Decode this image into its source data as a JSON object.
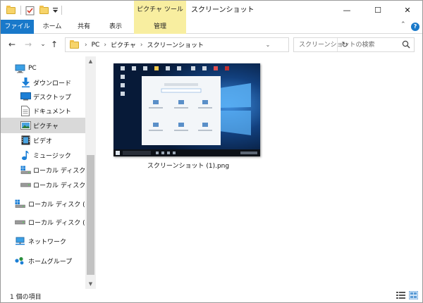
{
  "window": {
    "title": "スクリーンショット",
    "context_tab_title": "ピクチャ ツール",
    "controls": {
      "minimize": "—",
      "maximize": "☐",
      "close": "✕"
    }
  },
  "ribbon": {
    "tabs": [
      {
        "label": "ファイル"
      },
      {
        "label": "ホーム"
      },
      {
        "label": "共有"
      },
      {
        "label": "表示"
      },
      {
        "label": "管理"
      }
    ],
    "collapse_glyph": "⌃",
    "help_glyph": "?"
  },
  "address": {
    "back_glyph": "←",
    "forward_glyph": "→",
    "recent_glyph": "⌄",
    "up_glyph": "↑",
    "crumbs": [
      "PC",
      "ピクチャ",
      "スクリーンショット"
    ],
    "crumb_separator": "›",
    "refresh_glyph": "↻",
    "dropdown_glyph": "⌄",
    "search_placeholder": "スクリーンショットの検索"
  },
  "navpane": {
    "items": [
      {
        "label": "PC",
        "icon": "computer-icon"
      },
      {
        "label": "ダウンロード",
        "icon": "download-icon"
      },
      {
        "label": "デスクトップ",
        "icon": "desktop-icon"
      },
      {
        "label": "ドキュメント",
        "icon": "documents-icon"
      },
      {
        "label": "ピクチャ",
        "icon": "pictures-icon",
        "selected": true
      },
      {
        "label": "ビデオ",
        "icon": "videos-icon"
      },
      {
        "label": "ミュージック",
        "icon": "music-icon"
      },
      {
        "label": "ローカル ディスク (C",
        "icon": "os-drive-icon"
      },
      {
        "label": "ローカル ディスク (D",
        "icon": "drive-icon"
      },
      {
        "label": "ローカル ディスク (C:)",
        "icon": "os-drive-icon"
      },
      {
        "label": "ローカル ディスク (D:)",
        "icon": "drive-icon"
      },
      {
        "label": "ネットワーク",
        "icon": "network-icon"
      },
      {
        "label": "ホームグループ",
        "icon": "homegroup-icon"
      }
    ]
  },
  "files": [
    {
      "name": "スクリーンショット (1).png",
      "thumbnail": "windows-settings-screenshot"
    }
  ],
  "status": {
    "item_count_text": "1 個の項目"
  },
  "colors": {
    "accent_blue": "#1979ca",
    "context_tab_yellow": "#f8eea0",
    "selection_gray": "#d9d9d9"
  }
}
